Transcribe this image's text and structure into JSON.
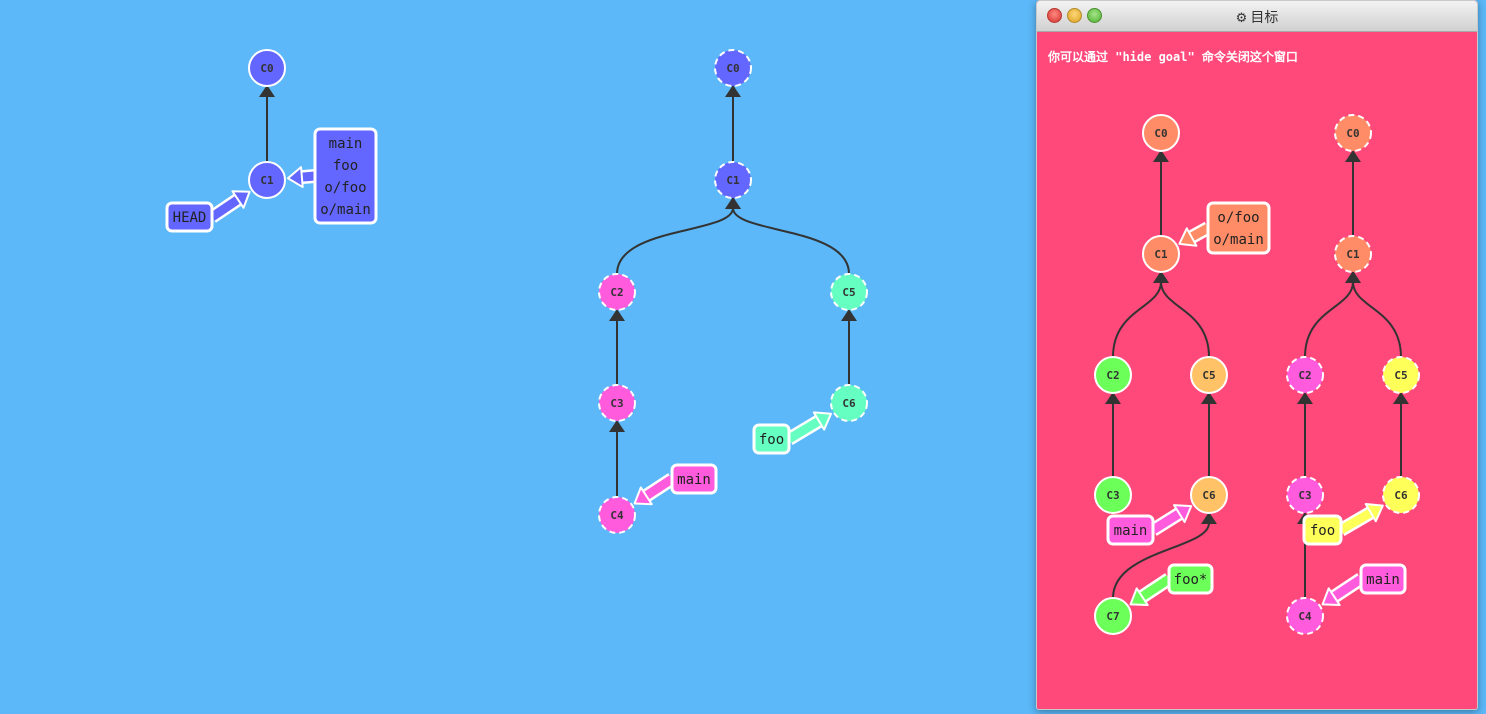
{
  "main_view": {
    "local": {
      "commits": [
        {
          "id": "C0",
          "color": "#6366ff",
          "dashed": false
        },
        {
          "id": "C1",
          "color": "#6366ff",
          "dashed": false
        }
      ],
      "branches": [
        {
          "label": "main\nfoo\no/foo\no/main",
          "target": "C1",
          "color": "#6366ff"
        },
        {
          "label": "HEAD",
          "target": "C1",
          "color": "#6366ff"
        }
      ]
    },
    "remote": {
      "commits": [
        {
          "id": "C0",
          "color": "#6366ff",
          "dashed": true
        },
        {
          "id": "C1",
          "color": "#6366ff",
          "dashed": true
        },
        {
          "id": "C2",
          "color": "#ff5bdc",
          "dashed": true
        },
        {
          "id": "C3",
          "color": "#ff5bdc",
          "dashed": true
        },
        {
          "id": "C4",
          "color": "#ff5bdc",
          "dashed": true
        },
        {
          "id": "C5",
          "color": "#66ffc2",
          "dashed": true
        },
        {
          "id": "C6",
          "color": "#66ffc2",
          "dashed": true
        }
      ],
      "branches": [
        {
          "label": "main",
          "target": "C4",
          "color": "#ff5bdc"
        },
        {
          "label": "foo",
          "target": "C6",
          "color": "#66ffc2"
        }
      ]
    }
  },
  "goal_window": {
    "title": "目标",
    "title_icon": "gear-icon",
    "hint": "你可以通过 \"hide goal\" 命令关闭这个窗口",
    "local": {
      "commits": [
        {
          "id": "C0",
          "color": "#ff8c66",
          "dashed": false
        },
        {
          "id": "C1",
          "color": "#ff8c66",
          "dashed": false
        },
        {
          "id": "C2",
          "color": "#6dff59",
          "dashed": false
        },
        {
          "id": "C3",
          "color": "#6dff59",
          "dashed": false
        },
        {
          "id": "C5",
          "color": "#ffc266",
          "dashed": false
        },
        {
          "id": "C6",
          "color": "#ffc266",
          "dashed": false
        },
        {
          "id": "C7",
          "color": "#6dff59",
          "dashed": false
        }
      ],
      "branches": [
        {
          "label": "o/foo\no/main",
          "target": "C1",
          "color": "#ff8c66"
        },
        {
          "label": "main",
          "target": "C6",
          "color": "#ff5bdc"
        },
        {
          "label": "foo*",
          "target": "C7",
          "color": "#6dff59"
        }
      ]
    },
    "remote": {
      "commits": [
        {
          "id": "C0",
          "color": "#ff8c66",
          "dashed": true
        },
        {
          "id": "C1",
          "color": "#ff8c66",
          "dashed": true
        },
        {
          "id": "C2",
          "color": "#ff5bdc",
          "dashed": true
        },
        {
          "id": "C3",
          "color": "#ff5bdc",
          "dashed": true
        },
        {
          "id": "C4",
          "color": "#ff5bdc",
          "dashed": true
        },
        {
          "id": "C5",
          "color": "#ffff59",
          "dashed": true
        },
        {
          "id": "C6",
          "color": "#ffff59",
          "dashed": true
        }
      ],
      "branches": [
        {
          "label": "foo",
          "target": "C6",
          "color": "#ffff59"
        },
        {
          "label": "main",
          "target": "C4",
          "color": "#ff5bdc"
        }
      ]
    }
  },
  "colors": {
    "background": "#5cb8f8",
    "goal_background": "#ff497b",
    "edge": "#333333"
  }
}
